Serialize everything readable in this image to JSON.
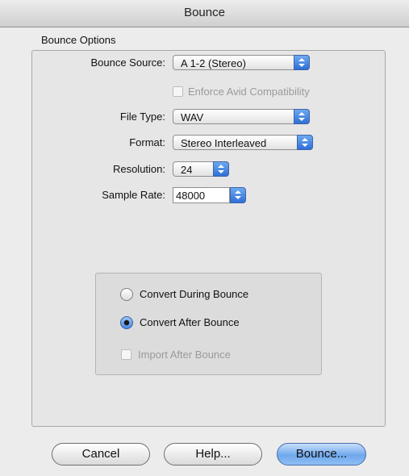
{
  "window": {
    "title": "Bounce"
  },
  "group": {
    "label": "Bounce Options"
  },
  "fields": {
    "bounce_source": {
      "label": "Bounce Source:",
      "value": "A 1-2 (Stereo)"
    },
    "enforce_avid": {
      "label": "Enforce Avid Compatibility",
      "checked": false,
      "enabled": false
    },
    "file_type": {
      "label": "File Type:",
      "value": "WAV"
    },
    "format": {
      "label": "Format:",
      "value": "Stereo Interleaved"
    },
    "resolution": {
      "label": "Resolution:",
      "value": "24"
    },
    "sample_rate": {
      "label": "Sample Rate:",
      "value": "48000"
    }
  },
  "conversion": {
    "options": [
      {
        "label": "Convert During Bounce",
        "selected": false
      },
      {
        "label": "Convert After Bounce",
        "selected": true
      }
    ],
    "import_after": {
      "label": "Import After Bounce",
      "checked": false,
      "enabled": false
    }
  },
  "buttons": {
    "cancel": "Cancel",
    "help": "Help...",
    "bounce": "Bounce..."
  },
  "colors": {
    "accent": "#4a8ae5",
    "window_bg": "#ececec"
  }
}
